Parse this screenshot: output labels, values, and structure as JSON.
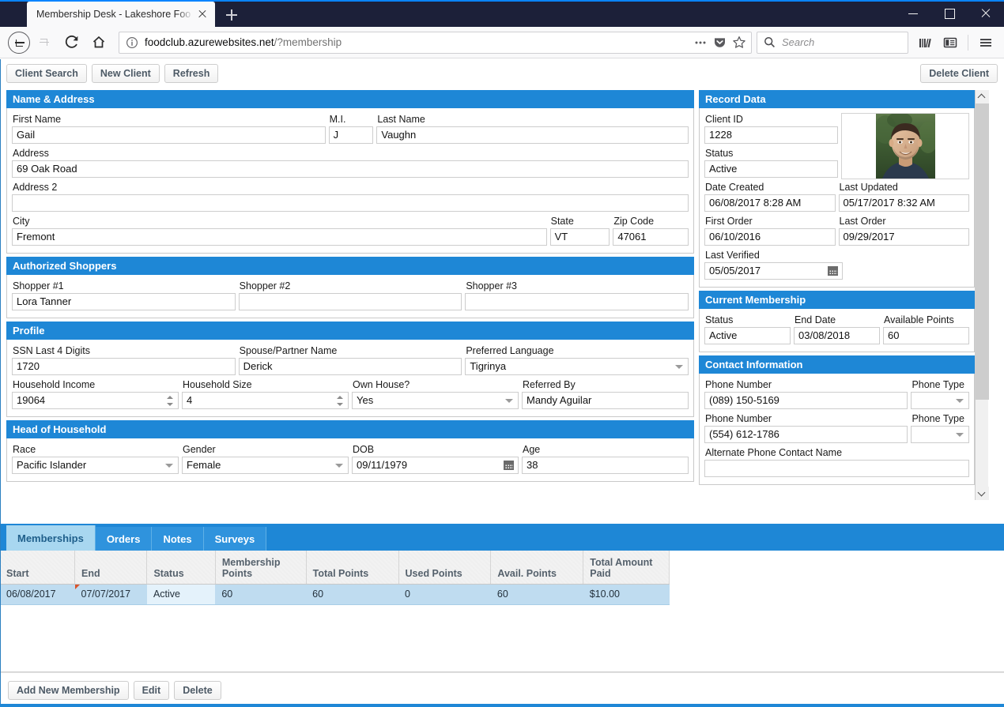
{
  "browser": {
    "tab_title": "Membership Desk - Lakeshore Foo",
    "url_main": "foodclub.azurewebsites.net",
    "url_query": "/?membership",
    "search_placeholder": "Search",
    "icons": {
      "back": "back-arrow-icon",
      "forward": "forward-arrow-icon",
      "reload": "reload-icon",
      "home": "home-icon",
      "info": "page-info-icon",
      "more": "more-options-icon",
      "pocket": "pocket-icon",
      "bookmark": "bookmark-star-icon",
      "search": "search-icon",
      "library": "library-icon",
      "sidebar": "sidebar-icon",
      "menu": "hamburger-menu-icon"
    }
  },
  "toolbar": {
    "client_search": "Client Search",
    "new_client": "New Client",
    "refresh": "Refresh",
    "delete_client": "Delete Client"
  },
  "name_address": {
    "title": "Name & Address",
    "first_name_label": "First Name",
    "first_name_value": "Gail",
    "mi_label": "M.I.",
    "mi_value": "J",
    "last_name_label": "Last Name",
    "last_name_value": "Vaughn",
    "address_label": "Address",
    "address_value": "69 Oak Road",
    "address2_label": "Address 2",
    "address2_value": "",
    "city_label": "City",
    "city_value": "Fremont",
    "state_label": "State",
    "state_value": "VT",
    "zip_label": "Zip Code",
    "zip_value": "47061"
  },
  "authorized_shoppers": {
    "title": "Authorized Shoppers",
    "shopper1_label": "Shopper #1",
    "shopper1_value": "Lora Tanner",
    "shopper2_label": "Shopper #2",
    "shopper2_value": "",
    "shopper3_label": "Shopper #3",
    "shopper3_value": ""
  },
  "profile": {
    "title": "Profile",
    "ssn_label": "SSN Last 4 Digits",
    "ssn_value": "1720",
    "spouse_label": "Spouse/Partner Name",
    "spouse_value": "Derick",
    "language_label": "Preferred Language",
    "language_value": "Tigrinya",
    "income_label": "Household Income",
    "income_value": "19064",
    "size_label": "Household Size",
    "size_value": "4",
    "own_house_label": "Own House?",
    "own_house_value": "Yes",
    "referred_label": "Referred By",
    "referred_value": "Mandy Aguilar"
  },
  "head_of_household": {
    "title": "Head of Household",
    "race_label": "Race",
    "race_value": "Pacific Islander",
    "gender_label": "Gender",
    "gender_value": "Female",
    "dob_label": "DOB",
    "dob_value": "09/11/1979",
    "age_label": "Age",
    "age_value": "38"
  },
  "record_data": {
    "title": "Record Data",
    "client_id_label": "Client ID",
    "client_id_value": "1228",
    "status_label": "Status",
    "status_value": "Active",
    "date_created_label": "Date Created",
    "date_created_value": "06/08/2017 8:28 AM",
    "last_updated_label": "Last Updated",
    "last_updated_value": "05/17/2017 8:32 AM",
    "first_order_label": "First Order",
    "first_order_value": "06/10/2016",
    "last_order_label": "Last Order",
    "last_order_value": "09/29/2017",
    "last_verified_label": "Last Verified",
    "last_verified_value": "05/05/2017",
    "photo_alt": "client-photo"
  },
  "current_membership": {
    "title": "Current Membership",
    "status_label": "Status",
    "status_value": "Active",
    "end_date_label": "End Date",
    "end_date_value": "03/08/2018",
    "available_points_label": "Available Points",
    "available_points_value": "60"
  },
  "contact_information": {
    "title": "Contact Information",
    "phone1_label": "Phone Number",
    "phone1_value": "(089) 150-5169",
    "phone1_type_label": "Phone Type",
    "phone1_type_value": "",
    "phone2_label": "Phone Number",
    "phone2_value": "(554) 612-1786",
    "phone2_type_label": "Phone Type",
    "phone2_type_value": "",
    "alt_contact_label": "Alternate Phone Contact Name"
  },
  "bottom_tabs": [
    {
      "label": "Memberships",
      "active": true
    },
    {
      "label": "Orders",
      "active": false
    },
    {
      "label": "Notes",
      "active": false
    },
    {
      "label": "Surveys",
      "active": false
    }
  ],
  "grid": {
    "columns": [
      "Start",
      "End",
      "Status",
      "Membership Points",
      "Total Points",
      "Used Points",
      "Avail. Points",
      "Total Amount Paid"
    ],
    "rows": [
      {
        "start": "06/08/2017",
        "end": "07/07/2017",
        "status": "Active",
        "membership_points": "60",
        "total_points": "60",
        "used_points": "0",
        "avail_points": "60",
        "total_amount_paid": "$10.00"
      }
    ]
  },
  "bottom_buttons": {
    "add_new_membership": "Add New Membership",
    "edit": "Edit",
    "delete": "Delete"
  },
  "colors": {
    "section_header": "#1e87d6",
    "titlebar": "#1c2039",
    "selected_row": "#bfdcf0",
    "active_tab": "#a8d7f0"
  }
}
